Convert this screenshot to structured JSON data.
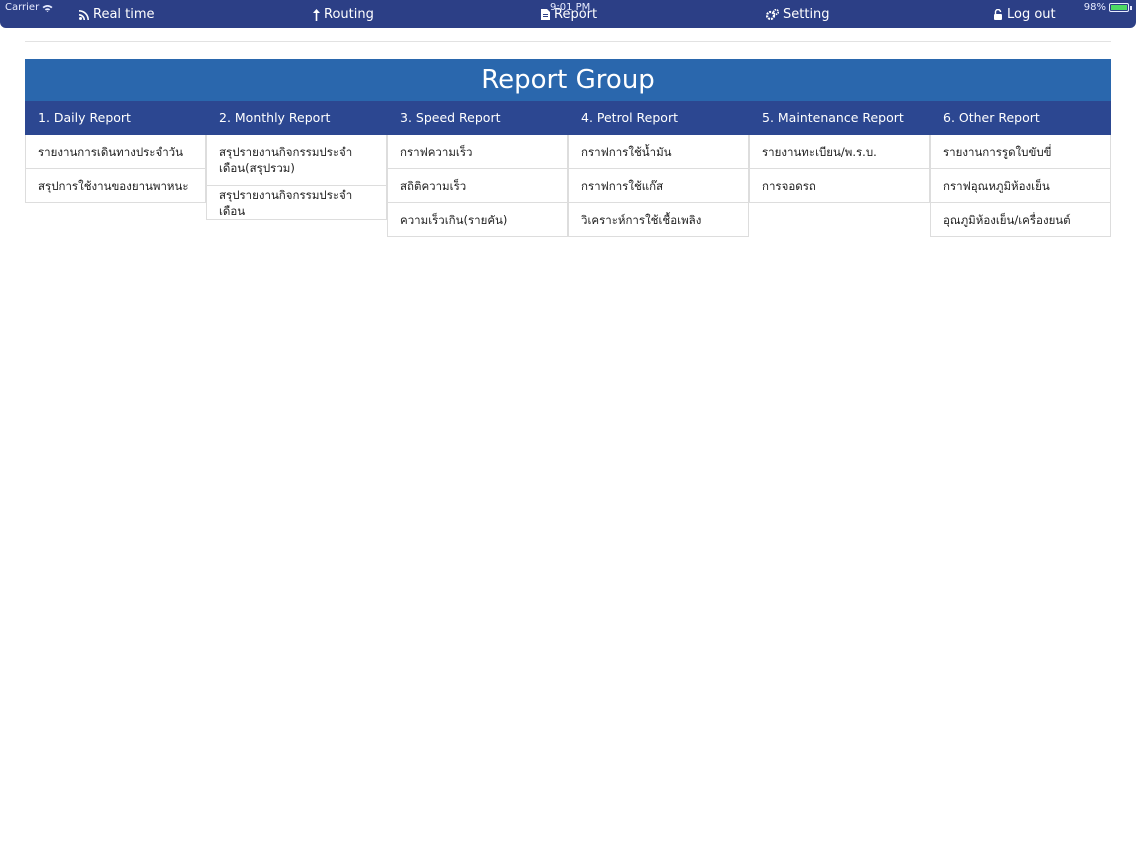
{
  "status": {
    "carrier": "Carrier",
    "time": "9:01 PM",
    "battery": "98%",
    "battery_level": 0.98
  },
  "nav": [
    {
      "label": "Real time",
      "icon": "rss-icon"
    },
    {
      "label": "Routing",
      "icon": "arrow-up-icon"
    },
    {
      "label": "Report",
      "icon": "document-icon"
    },
    {
      "label": "Setting",
      "icon": "gears-icon"
    },
    {
      "label": "Log out",
      "icon": "unlock-icon"
    }
  ],
  "title": "Report Group",
  "columns": [
    {
      "header": "1. Daily Report",
      "items": [
        "รายงานการเดินทางประจำวัน",
        "สรุปการใช้งานของยานพาหนะ"
      ]
    },
    {
      "header": "2. Monthly Report",
      "items": [
        "สรุปรายงานกิจกรรมประจำเดือน(สรุปรวม)",
        "สรุปรายงานกิจกรรมประจำเดือน"
      ]
    },
    {
      "header": "3. Speed Report",
      "items": [
        "กราฟความเร็ว",
        "สถิติความเร็ว",
        "ความเร็วเกิน(รายคัน)"
      ]
    },
    {
      "header": "4. Petrol Report",
      "items": [
        "กราฟการใช้น้ำมัน",
        "กราฟการใช้แก๊ส",
        "วิเคราะห์การใช้เชื้อเพลิง"
      ]
    },
    {
      "header": "5. Maintenance Report",
      "items": [
        "รายงานทะเบียน/พ.ร.บ.",
        "การจอดรถ"
      ]
    },
    {
      "header": "6. Other Report",
      "items": [
        "รายงานการรูดใบขับขี่",
        "กราฟอุณหภูมิห้องเย็น",
        "อุณภูมิห้องเย็น/เครื่องยนต์"
      ]
    }
  ]
}
